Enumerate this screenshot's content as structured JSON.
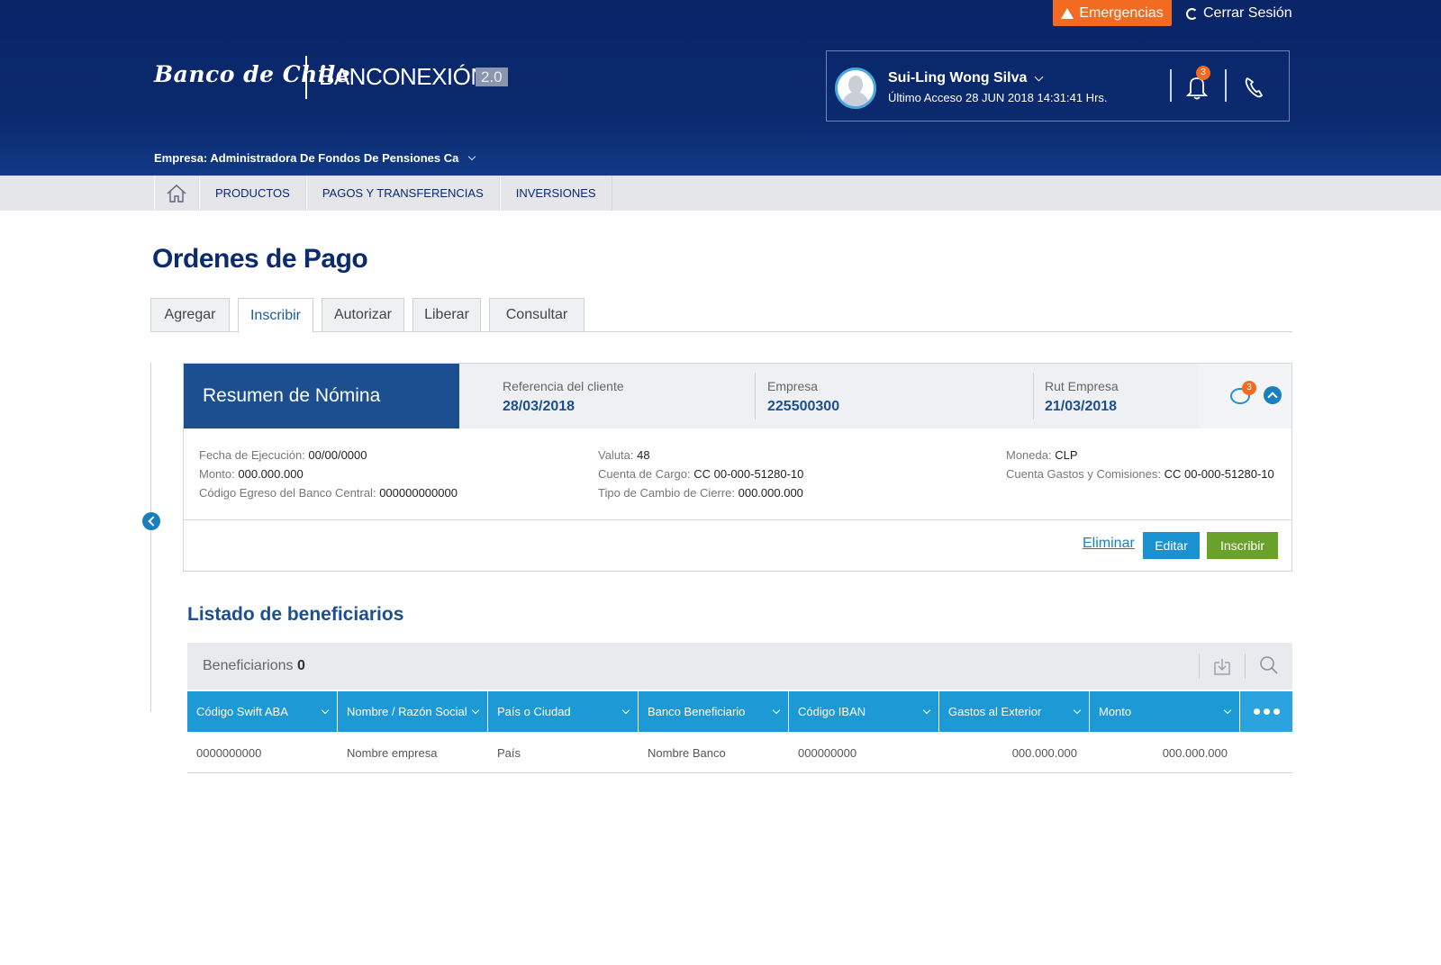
{
  "topbar": {
    "emergencias": "Emergencias",
    "logout": "Cerrar Sesión"
  },
  "brand": {
    "bank": "Banco de Chile",
    "product": "BANCONEXIÓN",
    "version": "2.0"
  },
  "user": {
    "name": "Sui-Ling Wong Silva",
    "last_access": "Último Acceso 28 JUN 2018 14:31:41 Hrs.",
    "notifications_count": "3"
  },
  "company_selector": "Empresa: Administradora De Fondos De Pensiones Ca",
  "nav": {
    "items": [
      "PRODUCTOS",
      "PAGOS Y TRANSFERENCIAS",
      "INVERSIONES"
    ]
  },
  "page_title": "Ordenes de Pago",
  "tabs": [
    "Agregar",
    "Inscribir",
    "Autorizar",
    "Liberar",
    "Consultar"
  ],
  "active_tab": "Inscribir",
  "summary": {
    "title": "Resumen de Nómina",
    "ref_label": "Referencia del cliente",
    "ref_value": "28/03/2018",
    "empresa_label": "Empresa",
    "empresa_value": "225500300",
    "rut_label": "Rut Empresa",
    "rut_value": "21/03/2018",
    "messages_count": "3",
    "details": {
      "fecha_label": "Fecha de Ejecución:",
      "fecha_value": "00/00/0000",
      "monto_label": "Monto:",
      "monto_value": "000.000.000",
      "codigo_label": "Código Egreso del Banco Central:",
      "codigo_value": "000000000000",
      "valuta_label": "Valuta:",
      "valuta_value": "48",
      "cuenta_cargo_label": "Cuenta de Cargo:",
      "cuenta_cargo_value": "CC 00-000-51280-10",
      "tipo_cambio_label": "Tipo de Cambio de Cierre:",
      "tipo_cambio_value": "000.000.000",
      "moneda_label": "Moneda:",
      "moneda_value": "CLP",
      "cuenta_gastos_label": "Cuenta Gastos y Comisiones:",
      "cuenta_gastos_value": "CC 00-000-51280-10"
    },
    "actions": {
      "delete": "Eliminar",
      "edit": "Editar",
      "register": "Inscribir"
    }
  },
  "beneficiaries": {
    "title": "Listado de beneficiarios",
    "count_label": "Beneficiarions",
    "count": "0",
    "columns": [
      "Código Swift  ABA",
      "Nombre / Razón Social",
      "País o Ciudad",
      "Banco Beneficiario",
      "Código IBAN",
      "Gastos al Exterior",
      "Monto"
    ],
    "rows": [
      [
        "0000000000",
        "Nombre empresa",
        "País",
        "Nombre Banco",
        "000000000",
        "000.000.000",
        "000.000.000"
      ]
    ]
  },
  "colors": {
    "header_navy": "#0b2a6f",
    "emergency_orange": "#f26b21",
    "table_header_blue": "#1b9ad6",
    "summary_blue": "#1c4f8f",
    "register_green": "#6aa12a"
  }
}
